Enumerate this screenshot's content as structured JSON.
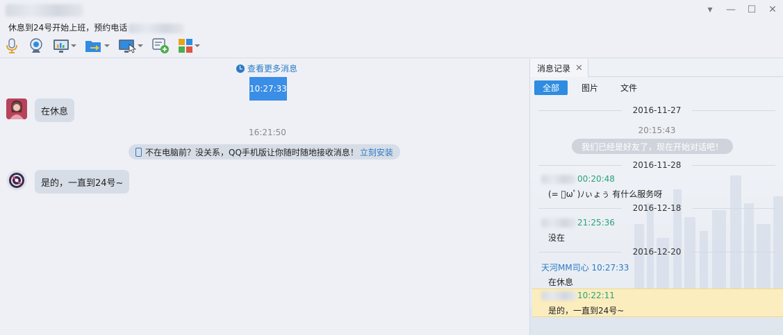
{
  "header": {
    "status_text": "休息到24号开始上班，预约电话"
  },
  "window_controls": [
    {
      "name": "dropdown",
      "glyph": "▾"
    },
    {
      "name": "minimize",
      "glyph": "—"
    },
    {
      "name": "maximize",
      "glyph": "☐"
    },
    {
      "name": "close",
      "glyph": "✕"
    }
  ],
  "toolbar": [
    {
      "icon": "microphone-icon",
      "has_menu": false
    },
    {
      "icon": "video-camera-icon",
      "has_menu": false
    },
    {
      "icon": "screen-share-icon",
      "has_menu": true
    },
    {
      "icon": "file-transfer-icon",
      "has_menu": true
    },
    {
      "icon": "remote-desktop-icon",
      "has_menu": true
    },
    {
      "icon": "new-chat-icon",
      "has_menu": false
    },
    {
      "icon": "apps-icon",
      "has_menu": true
    }
  ],
  "chat": {
    "more_messages": "查看更多消息",
    "time_selected": "10:27:33",
    "messages": [
      {
        "text": "在休息"
      },
      {
        "text": "是的，一直到24号~"
      }
    ],
    "time_2": "16:21:50",
    "tip": {
      "text": "不在电脑前？没关系，QQ手机版让你随时随地接收消息！",
      "link": "立刻安装"
    }
  },
  "history": {
    "tab_label": "消息记录",
    "tab_close": "✕",
    "filters": [
      "全部",
      "图片",
      "文件"
    ],
    "active_filter": "全部",
    "dates": [
      "2016-11-27",
      "2016-11-28",
      "2016-12-18",
      "2016-12-20"
    ],
    "time_center": "20:15:43",
    "system_message": "我们已经是好友了，现在开始对话吧！",
    "entries": [
      {
        "sender_time": "00:20:48",
        "text": "(= ﾟωﾟ)ﾉぃょぅ 有什么服务呀"
      },
      {
        "sender_time": "21:25:36",
        "text": "没在"
      },
      {
        "sender": "天河MM司心 10:27:33",
        "text": "在休息"
      },
      {
        "sender_time": "10:22:11",
        "text": "是的，一直到24号~"
      }
    ]
  },
  "colors": {
    "accent": "#2f8ce0",
    "selection": "#3a8ee6",
    "sender_green": "#2aa27a",
    "sender_blue": "#2b7bc5",
    "highlight": "#fbedbe",
    "bubble": "#d7dde6"
  }
}
